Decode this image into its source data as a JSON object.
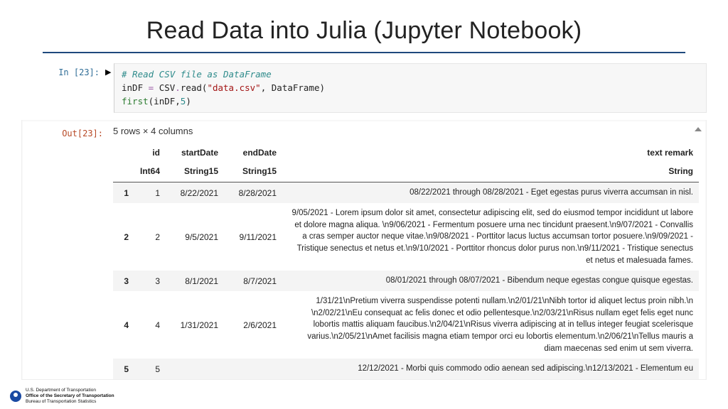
{
  "title": "Read Data into Julia (Jupyter Notebook)",
  "cell": {
    "in_prompt": "In [23]:",
    "out_prompt": "Out[23]:",
    "run_glyph": "▶❙",
    "code": {
      "comment": "# Read CSV file as DataFrame",
      "l2_a": "inDF ",
      "l2_eq": "=",
      "l2_b": " CSV",
      "l2_dot": ".",
      "l2_read": "read(",
      "l2_str": "\"data.csv\"",
      "l2_rest": ", DataFrame)",
      "l3_fn": "first",
      "l3_args_a": "(inDF,",
      "l3_num": "5",
      "l3_args_b": ")"
    }
  },
  "output": {
    "dims": "5 rows × 4 columns",
    "headers": {
      "idx": "",
      "id": "id",
      "start": "startDate",
      "end": "endDate",
      "text": "text remark"
    },
    "types": {
      "idx": "",
      "id": "Int64",
      "start": "String15",
      "end": "String15",
      "text": "String"
    },
    "rows": [
      {
        "n": "1",
        "id": "1",
        "start": "8/22/2021",
        "end": "8/28/2021",
        "text": "08/22/2021 through 08/28/2021 - Eget egestas purus viverra accumsan in nisl."
      },
      {
        "n": "2",
        "id": "2",
        "start": "9/5/2021",
        "end": "9/11/2021",
        "text": "9/05/2021 - Lorem ipsum dolor sit amet, consectetur adipiscing elit, sed do eiusmod tempor incididunt ut labore et dolore magna aliqua. \\n9/06/2021 - Fermentum posuere urna nec tincidunt praesent.\\n9/07/2021 - Convallis a cras semper auctor neque vitae.\\n9/08/2021 - Porttitor lacus luctus accumsan tortor posuere.\\n9/09/2021 - Tristique senectus et netus et.\\n9/10/2021 - Porttitor rhoncus dolor purus non.\\n9/11/2021 - Tristique senectus et netus et malesuada fames."
      },
      {
        "n": "3",
        "id": "3",
        "start": "8/1/2021",
        "end": "8/7/2021",
        "text": "08/01/2021 through 08/07/2021 - Bibendum neque egestas congue quisque egestas."
      },
      {
        "n": "4",
        "id": "4",
        "start": "1/31/2021",
        "end": "2/6/2021",
        "text": "1/31/21\\nPretium viverra suspendisse potenti nullam.\\n2/01/21\\nNibh tortor id aliquet lectus proin nibh.\\n \\n2/02/21\\nEu consequat ac felis donec et odio pellentesque.\\n2/03/21\\nRisus nullam eget felis eget nunc lobortis mattis aliquam faucibus.\\n2/04/21\\nRisus viverra adipiscing at in tellus integer feugiat scelerisque varius.\\n2/05/21\\nAmet facilisis magna etiam tempor orci eu lobortis elementum.\\n2/06/21\\nTellus mauris a diam maecenas sed enim ut sem viverra."
      },
      {
        "n": "5",
        "id": "5",
        "start": "",
        "end": "",
        "text": "12/12/2021 - Morbi quis commodo odio aenean sed adipiscing.\\n12/13/2021 - Elementum eu"
      }
    ]
  },
  "footer": {
    "l1": "U.S. Department of Transportation",
    "l2": "Office of the Secretary of Transportation",
    "l3": "Bureau of Transportation Statistics"
  }
}
